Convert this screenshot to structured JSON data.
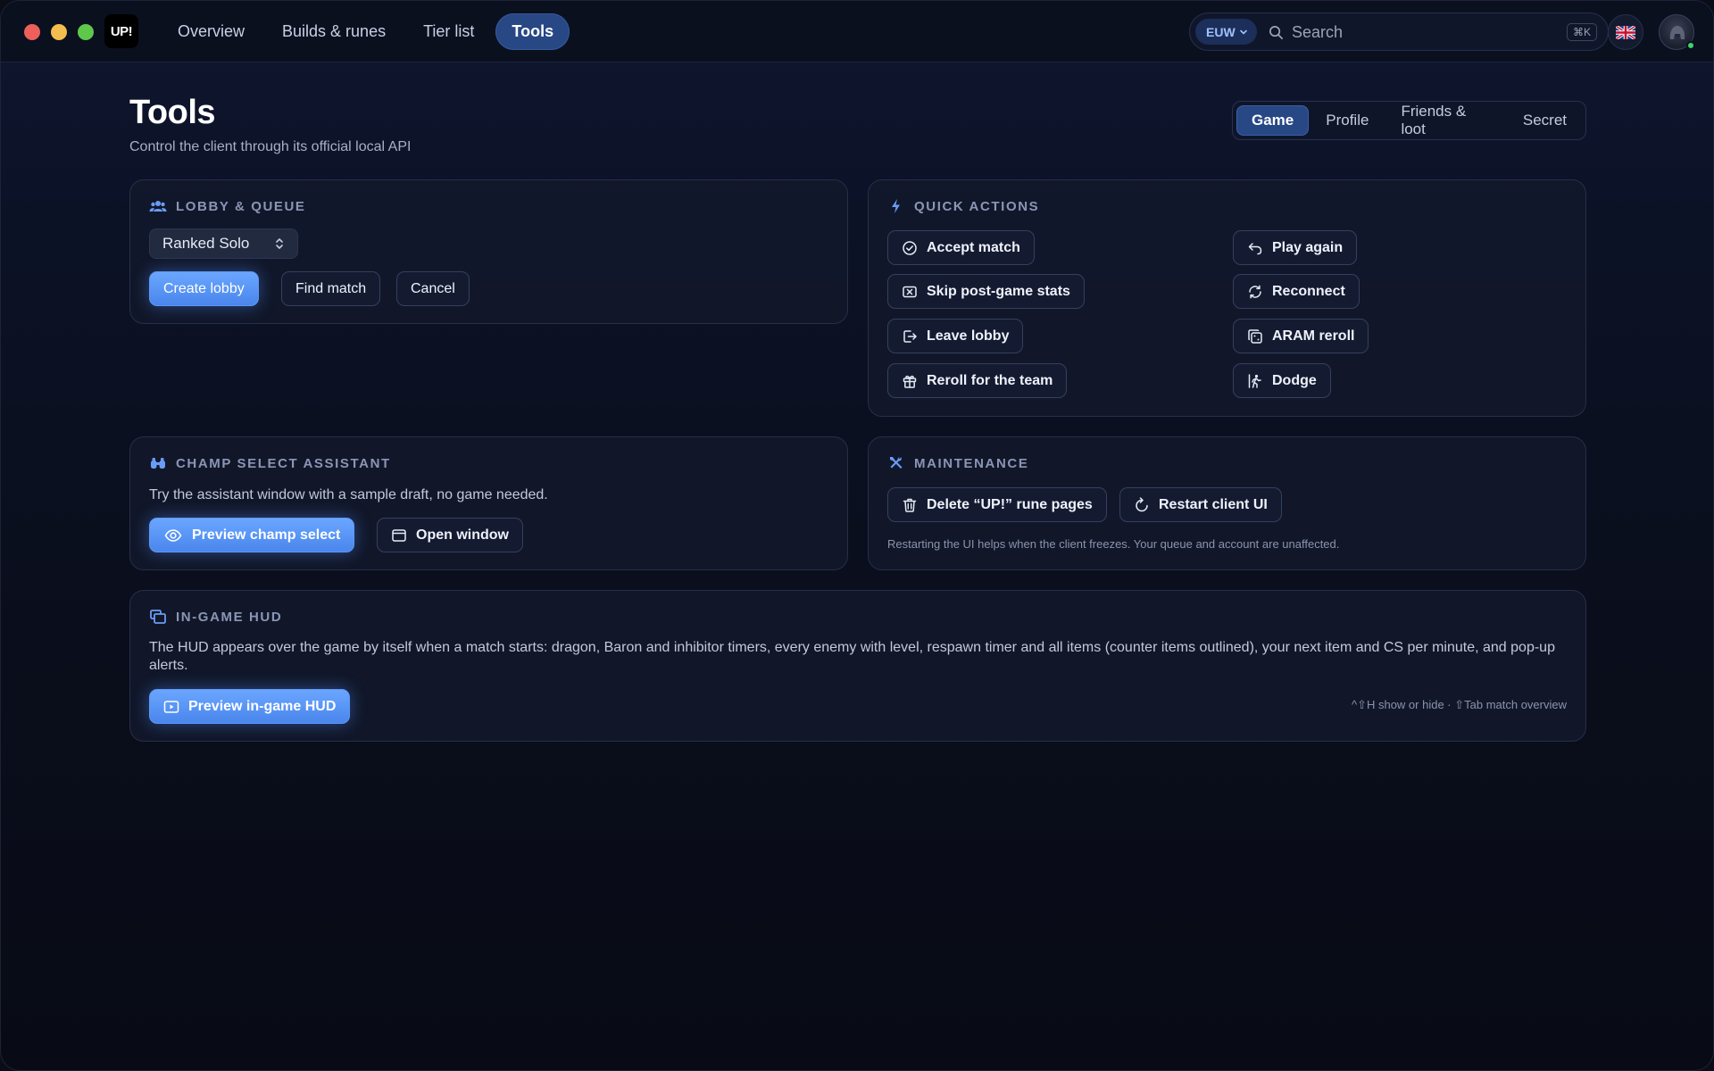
{
  "app": {
    "logo_text": "UP!"
  },
  "nav": {
    "items": [
      {
        "label": "Overview"
      },
      {
        "label": "Builds & runes"
      },
      {
        "label": "Tier list"
      },
      {
        "label": "Tools"
      }
    ],
    "active_index": 3
  },
  "search": {
    "region": "EUW",
    "placeholder": "Search",
    "shortcut": "⌘K"
  },
  "language": {
    "flag": "🇬🇧"
  },
  "user": {
    "online": true
  },
  "page": {
    "title": "Tools",
    "subtitle": "Control the client through its official local API"
  },
  "tabs": {
    "items": [
      {
        "label": "Game"
      },
      {
        "label": "Profile"
      },
      {
        "label": "Friends & loot"
      },
      {
        "label": "Secret"
      }
    ],
    "active_index": 0
  },
  "lobby": {
    "title": "LOBBY & QUEUE",
    "queue_value": "Ranked Solo",
    "create_label": "Create lobby",
    "find_label": "Find match",
    "cancel_label": "Cancel"
  },
  "quick_actions": {
    "title": "QUICK ACTIONS",
    "accept": "Accept match",
    "play_again": "Play again",
    "skip_stats": "Skip post-game stats",
    "reconnect": "Reconnect",
    "leave_lobby": "Leave lobby",
    "aram_reroll": "ARAM reroll",
    "reroll_team": "Reroll for the team",
    "dodge": "Dodge"
  },
  "champ_select": {
    "title": "CHAMP SELECT ASSISTANT",
    "description": "Try the assistant window with a sample draft, no game needed.",
    "preview_label": "Preview champ select",
    "open_label": "Open window"
  },
  "maintenance": {
    "title": "MAINTENANCE",
    "delete_label": "Delete “UP!” rune pages",
    "restart_label": "Restart client UI",
    "note": "Restarting the UI helps when the client freezes. Your queue and account are unaffected."
  },
  "hud": {
    "title": "IN-GAME HUD",
    "description": "The HUD appears over the game by itself when a match starts: dragon, Baron and inhibitor timers, every enemy with level, respawn timer and all items (counter items outlined), your next item and CS per minute, and pop-up alerts.",
    "preview_label": "Preview in-game HUD",
    "hint": "^⇧H show or hide · ⇧Tab match overview"
  },
  "colors": {
    "accent": "#5b96f7",
    "active_tab": "#274785",
    "background": "#0a0e1c",
    "card": "#12182a",
    "online": "#3dd56d"
  }
}
